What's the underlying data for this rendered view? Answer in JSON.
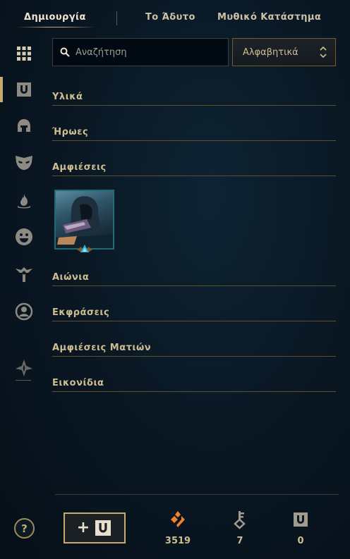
{
  "nav": {
    "tabs": [
      {
        "label": "Δημιουργία",
        "active": true
      },
      {
        "label": "Το Άδυτο",
        "active": false
      },
      {
        "label": "Μυθικό Κατάστημα",
        "active": false
      }
    ]
  },
  "rail": {
    "items": [
      {
        "icon": "grid-icon",
        "active": true
      },
      {
        "icon": "chest-icon"
      },
      {
        "icon": "helmet-icon"
      },
      {
        "icon": "mask-icon"
      },
      {
        "icon": "flame-icon"
      },
      {
        "icon": "emote-face-icon"
      },
      {
        "icon": "ward-icon"
      },
      {
        "icon": "profile-icon"
      },
      {
        "icon": "crest-icon"
      }
    ]
  },
  "search": {
    "placeholder": "Αναζήτηση"
  },
  "sort": {
    "selected": "Αλφαβητικά"
  },
  "categories": [
    {
      "label": "Υλικά"
    },
    {
      "label": "Ήρωες"
    },
    {
      "label": "Αμφιέσεις"
    },
    {
      "label": "Αιώνια"
    },
    {
      "label": "Εκφράσεις"
    },
    {
      "label": "Αμφιέσεις Ματιών"
    },
    {
      "label": "Εικονίδια"
    }
  ],
  "skins": [
    {
      "icon": "hooded-champion-skin-portrait",
      "rarity": "epic-rarity-gem-icon"
    }
  ],
  "footer": {
    "help": "?",
    "add_button": {
      "plus": "+",
      "icon": "chest-icon"
    },
    "currencies": [
      {
        "icon": "orange-essence-icon",
        "value": "3519",
        "color": "#f0832a"
      },
      {
        "icon": "key-icon",
        "value": "7",
        "color": "#a09b8c"
      },
      {
        "icon": "chest-icon",
        "value": "0",
        "color": "#a09b8c"
      }
    ]
  },
  "colors": {
    "gold": "#c8aa6e",
    "background": "#0a1824",
    "text": "#cdbe91"
  }
}
